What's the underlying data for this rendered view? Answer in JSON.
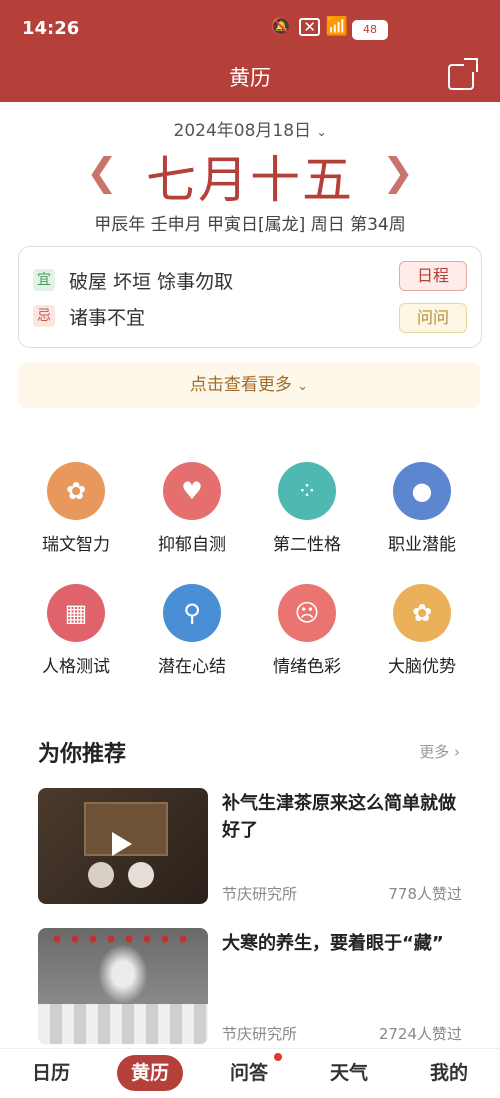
{
  "status": {
    "time": "14:26",
    "battery": "48"
  },
  "header": {
    "title": "黄历"
  },
  "calendar": {
    "date": "2024年08月18日",
    "lunar": "七月十五",
    "ganzhi": "甲辰年 壬申月 甲寅日[属龙] 周日 第34周"
  },
  "yiji": {
    "yi_tag": "宜",
    "yi_text": "破屋 坏垣 馀事勿取",
    "ji_tag": "忌",
    "ji_text": "诸事不宜",
    "schedule_label": "日程",
    "ask_label": "问问"
  },
  "more_label": "点击查看更多",
  "tools": [
    {
      "label": "瑞文智力",
      "color": "#e8985c",
      "icon": "brain-icon"
    },
    {
      "label": "抑郁自测",
      "color": "#e56f6f",
      "icon": "broken-heart-icon"
    },
    {
      "label": "第二性格",
      "color": "#4fb8b1",
      "icon": "head-dots-icon"
    },
    {
      "label": "职业潜能",
      "color": "#5d86d1",
      "icon": "person-tie-icon"
    },
    {
      "label": "人格测试",
      "color": "#e0626a",
      "icon": "blocks-icon"
    },
    {
      "label": "潜在心结",
      "color": "#4a8ed6",
      "icon": "head-key-icon"
    },
    {
      "label": "情绪色彩",
      "color": "#ea7470",
      "icon": "sad-file-icon"
    },
    {
      "label": "大脑优势",
      "color": "#eab15a",
      "icon": "brain-icon"
    }
  ],
  "recommend": {
    "title": "为你推荐",
    "more": "更多",
    "articles": [
      {
        "title": "补气生津茶原来这么简单就做好了",
        "source": "节庆研究所",
        "likes": "778人赞过"
      },
      {
        "title": "大寒的养生，要着眼于“藏”",
        "source": "节庆研究所",
        "likes": "2724人赞过"
      }
    ]
  },
  "tabbar": [
    {
      "label": "日历"
    },
    {
      "label": "黄历"
    },
    {
      "label": "问答"
    },
    {
      "label": "天气"
    },
    {
      "label": "我的"
    }
  ],
  "colors": {
    "brand": "#b5403a"
  }
}
